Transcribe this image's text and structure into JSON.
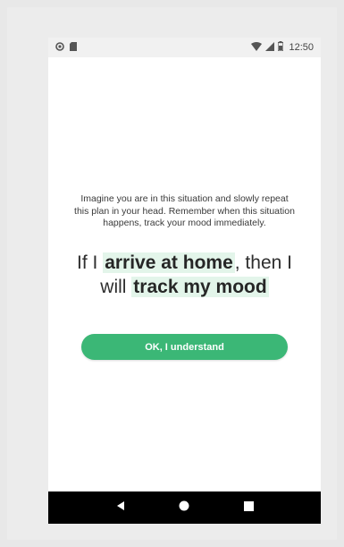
{
  "status_bar": {
    "left_icons": [
      "record-icon",
      "sim-card-icon"
    ],
    "right_icons": [
      "wifi-icon",
      "cell-signal-icon",
      "battery-icon"
    ],
    "time": "12:50"
  },
  "screen": {
    "instructions_line1": "Imagine you are in this situation and slowly repeat",
    "instructions_line2": "this plan in your head. Remember when this situation",
    "instructions_line3": "happens, track your mood immediately.",
    "plan": {
      "if_prefix": "If I ",
      "trigger": "arrive at home",
      "then_suffix": ", then I",
      "will_prefix": "will ",
      "action": "track my mood"
    },
    "confirm_button_label": "OK, I understand"
  },
  "navigation": {
    "buttons": [
      "back-icon",
      "home-icon",
      "recents-icon"
    ]
  },
  "colors": {
    "accent": "#3bb776",
    "highlight": "#e3f5ea",
    "nav_bar": "#000000"
  }
}
